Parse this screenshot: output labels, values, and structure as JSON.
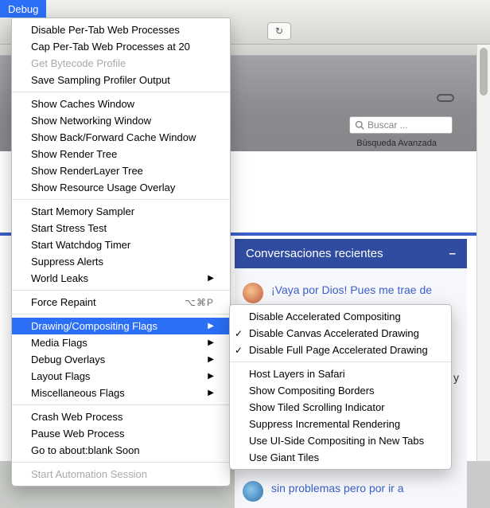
{
  "menubar": {
    "debug_label": "Debug"
  },
  "toolbar": {
    "reload_glyph": "↻"
  },
  "site": {
    "search_placeholder": "Buscar ...",
    "advanced_search_label": "Búsqueda Avanzada",
    "panel_title": "Conversaciones recientes",
    "posts": [
      {
        "title": "¡Vaya por Dios! Pues me trae de"
      },
      {
        "title_link_fragment": "",
        "title_trailing": "x y"
      },
      {
        "title": "sin problemas  pero por ir a"
      }
    ]
  },
  "menu_main": {
    "groups": [
      {
        "items": [
          {
            "label": "Disable Per-Tab Web Processes"
          },
          {
            "label": "Cap Per-Tab Web Processes at 20"
          },
          {
            "label": "Get Bytecode Profile",
            "disabled": true
          },
          {
            "label": "Save Sampling Profiler Output"
          }
        ]
      },
      {
        "items": [
          {
            "label": "Show Caches Window"
          },
          {
            "label": "Show Networking Window"
          },
          {
            "label": "Show Back/Forward Cache Window"
          },
          {
            "label": "Show Render Tree"
          },
          {
            "label": "Show RenderLayer Tree"
          },
          {
            "label": "Show Resource Usage Overlay"
          }
        ]
      },
      {
        "items": [
          {
            "label": "Start Memory Sampler"
          },
          {
            "label": "Start Stress Test"
          },
          {
            "label": "Start Watchdog Timer"
          },
          {
            "label": "Suppress Alerts"
          },
          {
            "label": "World Leaks",
            "submenu": true
          }
        ]
      },
      {
        "items": [
          {
            "label": "Force Repaint",
            "shortcut": "⌥⌘P"
          }
        ]
      },
      {
        "items": [
          {
            "label": "Drawing/Compositing Flags",
            "submenu": true,
            "highlight": true
          },
          {
            "label": "Media Flags",
            "submenu": true
          },
          {
            "label": "Debug Overlays",
            "submenu": true
          },
          {
            "label": "Layout Flags",
            "submenu": true
          },
          {
            "label": "Miscellaneous Flags",
            "submenu": true
          }
        ]
      },
      {
        "items": [
          {
            "label": "Crash Web Process"
          },
          {
            "label": "Pause Web Process"
          },
          {
            "label": "Go to about:blank Soon"
          }
        ]
      },
      {
        "items": [
          {
            "label": "Start Automation Session",
            "disabled": true
          }
        ]
      }
    ]
  },
  "menu_sub": {
    "groups": [
      {
        "items": [
          {
            "label": "Disable Accelerated Compositing"
          },
          {
            "label": "Disable Canvas Accelerated Drawing",
            "checked": true
          },
          {
            "label": "Disable Full Page Accelerated Drawing",
            "checked": true
          }
        ]
      },
      {
        "items": [
          {
            "label": "Host Layers in Safari"
          },
          {
            "label": "Show Compositing Borders"
          },
          {
            "label": "Show Tiled Scrolling Indicator"
          },
          {
            "label": "Suppress Incremental Rendering"
          },
          {
            "label": "Use UI-Side Compositing in New Tabs"
          },
          {
            "label": "Use Giant Tiles"
          }
        ]
      }
    ]
  }
}
